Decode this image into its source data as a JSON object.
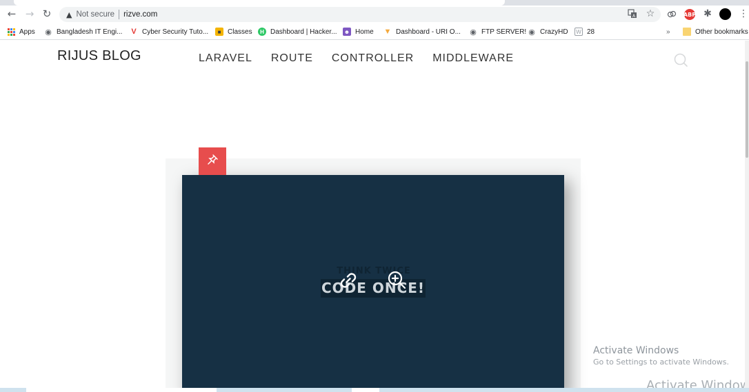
{
  "browser": {
    "not_secure_label": "Not secure",
    "url": "rizve.com",
    "bookmarks": [
      {
        "label": "Apps",
        "icon": "apps-grid-icon",
        "color": "#ea4335"
      },
      {
        "label": "Bangladesh IT Engi...",
        "icon": "globe-icon",
        "color": "#5f6368"
      },
      {
        "label": "Cyber Security Tuto...",
        "icon": "v-logo-icon",
        "color": "#e53935"
      },
      {
        "label": "Classes",
        "icon": "classes-icon",
        "color": "#f4b400"
      },
      {
        "label": "Dashboard | Hacker...",
        "icon": "hackerrank-icon",
        "color": "#2ec866"
      },
      {
        "label": "Home",
        "icon": "home-avatar-icon",
        "color": "#7e57c2"
      },
      {
        "label": "Dashboard - URI O...",
        "icon": "uri-icon",
        "color": "#f4a93c"
      },
      {
        "label": "FTP SERVER!",
        "icon": "globe-icon",
        "color": "#5f6368"
      },
      {
        "label": "CrazyHD",
        "icon": "globe-icon",
        "color": "#5f6368"
      },
      {
        "label": "28",
        "icon": "w-icon",
        "color": "#9aa0a6"
      }
    ],
    "overflow_label": "»",
    "other_bookmarks_label": "Other bookmarks"
  },
  "site": {
    "title": "RIJUS BLOG",
    "nav": [
      "LARAVEL",
      "ROUTE",
      "CONTROLLER",
      "MIDDLEWARE"
    ]
  },
  "post": {
    "image_text_small": "THINK TWICE",
    "image_text_big": "CODE ONCE!",
    "badge_color": "#e74d4d",
    "image_bg_color": "#163044"
  },
  "watermark": {
    "title": "Activate Windows",
    "subtitle": "Go to Settings to activate Windows.",
    "duplicate": "Activate Windows"
  }
}
